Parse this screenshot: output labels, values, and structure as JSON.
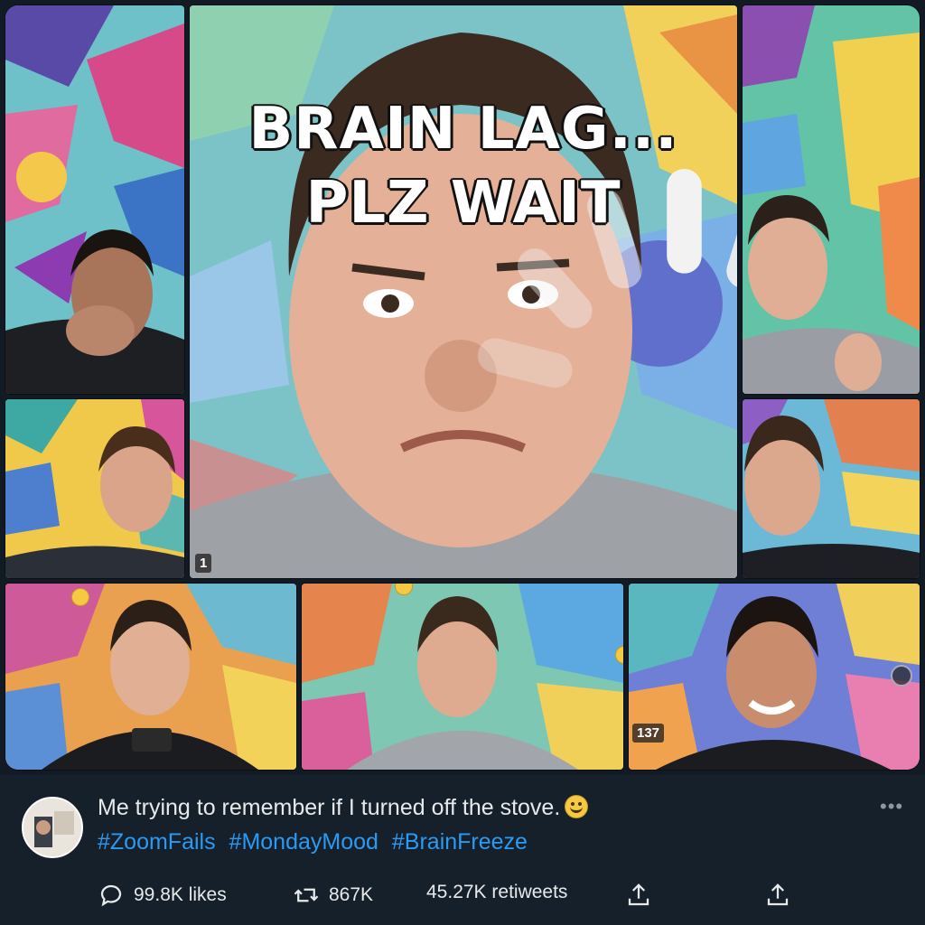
{
  "media": {
    "caption_line1": "BRAIN LAG...",
    "caption_line2": "PLZ WAIT",
    "main_counter": "1",
    "bottom_counter": "137"
  },
  "tweet": {
    "text": "Me trying to remember if I turned off the stove.",
    "hashtags": [
      "#ZoomFails",
      "#MondayMood",
      "#BrainFreeze"
    ],
    "more_label": "•••"
  },
  "actions": {
    "reply_count": "99.8K likes",
    "retweet_count": "867K",
    "like_count": "45.27K retiweets"
  },
  "colors": {
    "background": "#15202b",
    "hashtag": "#2b9af3",
    "text": "#e7e9ea",
    "muted": "#8b98a5"
  }
}
